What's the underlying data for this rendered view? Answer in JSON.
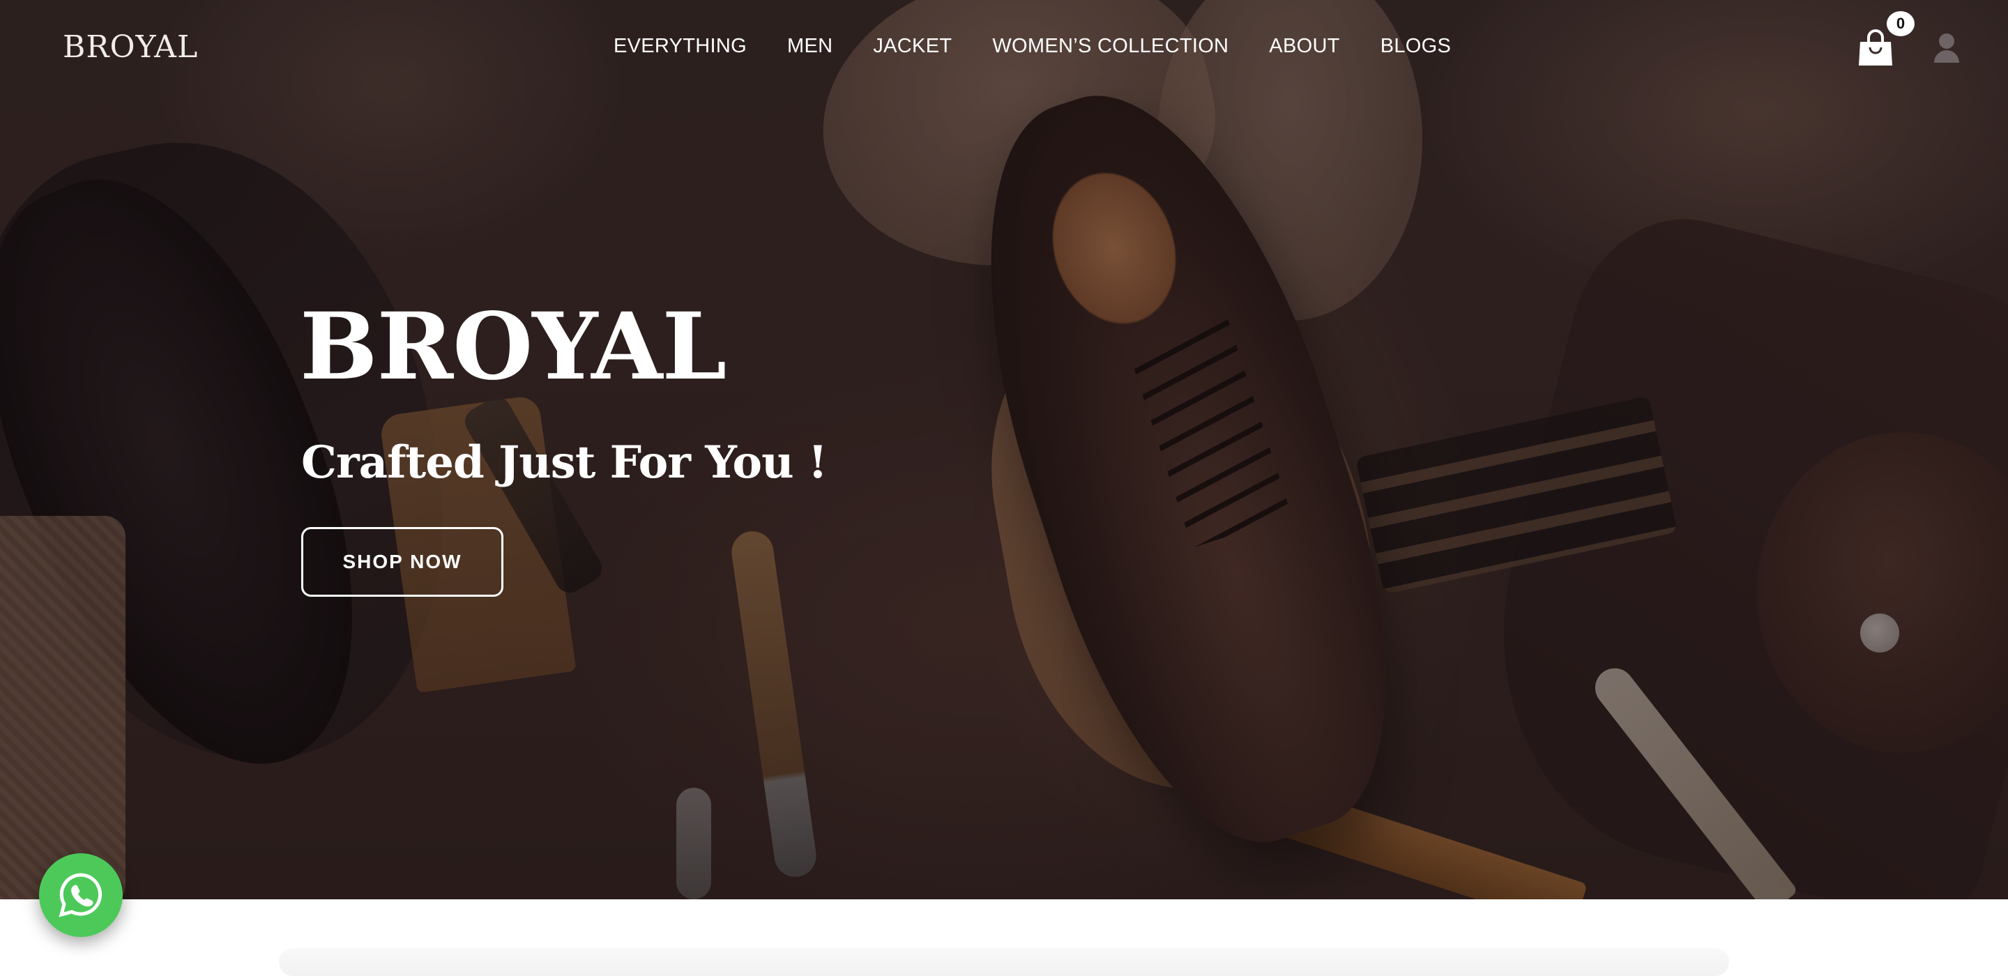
{
  "brand": {
    "logo_text": "BROYAL"
  },
  "nav": {
    "items": [
      {
        "label": "EVERYTHING"
      },
      {
        "label": "MEN"
      },
      {
        "label": "JACKET"
      },
      {
        "label": "WOMEN’S COLLECTION"
      },
      {
        "label": "ABOUT"
      },
      {
        "label": "BLOGS"
      }
    ]
  },
  "header": {
    "cart_icon": "shopping-bag-icon",
    "cart_count": "0",
    "user_icon": "user-icon"
  },
  "hero": {
    "title": "BROYAL",
    "subtitle": "Crafted Just For You !",
    "cta_label": "SHOP NOW"
  },
  "floating": {
    "whatsapp_icon": "whatsapp-icon",
    "whatsapp_color": "#4dc95a"
  },
  "colors": {
    "text_on_hero": "#ffffff",
    "badge_bg": "#ffffff"
  }
}
